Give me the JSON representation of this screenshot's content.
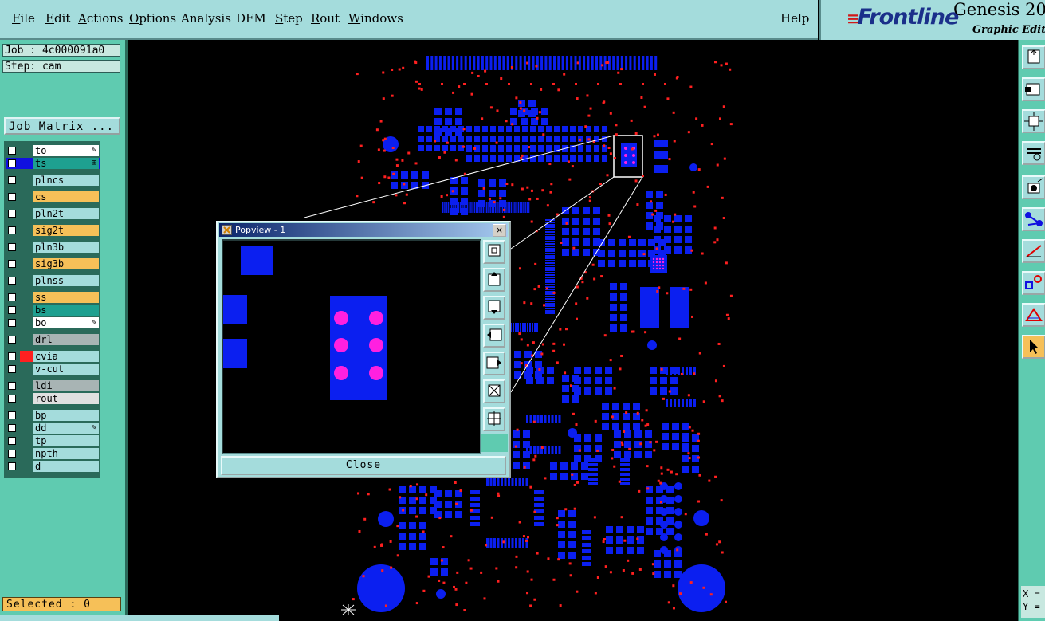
{
  "menubar": {
    "items": [
      {
        "label": "File",
        "u": "F",
        "rest": "ile"
      },
      {
        "label": "Edit",
        "u": "E",
        "rest": "dit"
      },
      {
        "label": "Actions",
        "u": "A",
        "rest": "ctions"
      },
      {
        "label": "Options",
        "u": "O",
        "rest": "ptions"
      },
      {
        "label": "Analysis",
        "u": "",
        "rest": "Analysis"
      },
      {
        "label": "DFM",
        "u": "",
        "rest": "DFM"
      },
      {
        "label": "Step",
        "u": "S",
        "rest": "tep"
      },
      {
        "label": "Rout",
        "u": "R",
        "rest": "out"
      },
      {
        "label": "Windows",
        "u": "W",
        "rest": "indows"
      }
    ],
    "help": "Help"
  },
  "brand": {
    "logo_prefix": "F",
    "logo_rest": "rontline",
    "title": "Genesis 20",
    "subtitle": "Graphic Editor"
  },
  "job": {
    "job_label": "Job : 4c000091a0",
    "step_label": "Step: cam"
  },
  "job_matrix_button": "Job Matrix ...",
  "layers": [
    {
      "name": "to",
      "color": "#ffffff",
      "mark": "✎",
      "sel": ""
    },
    {
      "name": "ts",
      "color": "#1ea090",
      "mark": "⊞",
      "sel": "#1010e0"
    },
    {
      "name": "plncs",
      "color": "#a4dcdc",
      "mark": "",
      "sel": ""
    },
    {
      "name": "cs",
      "color": "#f6c058",
      "mark": "",
      "sel": ""
    },
    {
      "name": "pln2t",
      "color": "#a4dcdc",
      "mark": "",
      "sel": ""
    },
    {
      "name": "sig2t",
      "color": "#f6c058",
      "mark": "",
      "sel": ""
    },
    {
      "name": "pln3b",
      "color": "#a4dcdc",
      "mark": "",
      "sel": ""
    },
    {
      "name": "sig3b",
      "color": "#f6c058",
      "mark": "",
      "sel": ""
    },
    {
      "name": "plnss",
      "color": "#a4dcdc",
      "mark": "",
      "sel": ""
    },
    {
      "name": "ss",
      "color": "#f6c058",
      "mark": "",
      "sel": ""
    },
    {
      "name": "bs",
      "color": "#1ea090",
      "mark": "",
      "sel": ""
    },
    {
      "name": "bo",
      "color": "#ffffff",
      "mark": "✎",
      "sel": ""
    },
    {
      "name": "drl",
      "color": "#a8b4b4",
      "mark": "",
      "sel": ""
    },
    {
      "name": "cvia",
      "color": "#a4dcdc",
      "mark": "",
      "sel": "#ff2020"
    },
    {
      "name": "v-cut",
      "color": "#a4dcdc",
      "mark": "",
      "sel": ""
    },
    {
      "name": "ldi",
      "color": "#a8b4b4",
      "mark": "",
      "sel": ""
    },
    {
      "name": "rout",
      "color": "#e0e0e0",
      "mark": "",
      "sel": ""
    },
    {
      "name": "bp",
      "color": "#a4dcdc",
      "mark": "",
      "sel": ""
    },
    {
      "name": "dd",
      "color": "#a4dcdc",
      "mark": "✎",
      "sel": ""
    },
    {
      "name": "tp",
      "color": "#a4dcdc",
      "mark": "",
      "sel": ""
    },
    {
      "name": "npth",
      "color": "#a4dcdc",
      "mark": "",
      "sel": ""
    },
    {
      "name": "d",
      "color": "#a4dcdc",
      "mark": "",
      "sel": ""
    }
  ],
  "selected_label": "Selected : 0",
  "coords": {
    "x": "X =",
    "y": "Y ="
  },
  "popview": {
    "title": "Popview - 1",
    "close_label": "Close",
    "close_x": "×"
  },
  "colors": {
    "pad": "#0b1ff0",
    "smd": "#ff20e0",
    "drill": "#ff2020",
    "panel": "#5fcbb0",
    "menu": "#a4dcdc"
  },
  "icons": {
    "right_toolbar": [
      "open-window-icon",
      "zoom-window-icon",
      "fit-icon",
      "measure-icon",
      "snap-icon",
      "net-icon",
      "draw-line-icon",
      "select-feature-icon",
      "triangle-icon",
      "pointer-icon"
    ],
    "popview_toolbar": [
      "zoom-in-icon",
      "pan-up-icon",
      "pan-down-icon",
      "pan-left-icon",
      "pan-right-icon",
      "zoom-fit-icon",
      "zoom-home-icon"
    ]
  }
}
